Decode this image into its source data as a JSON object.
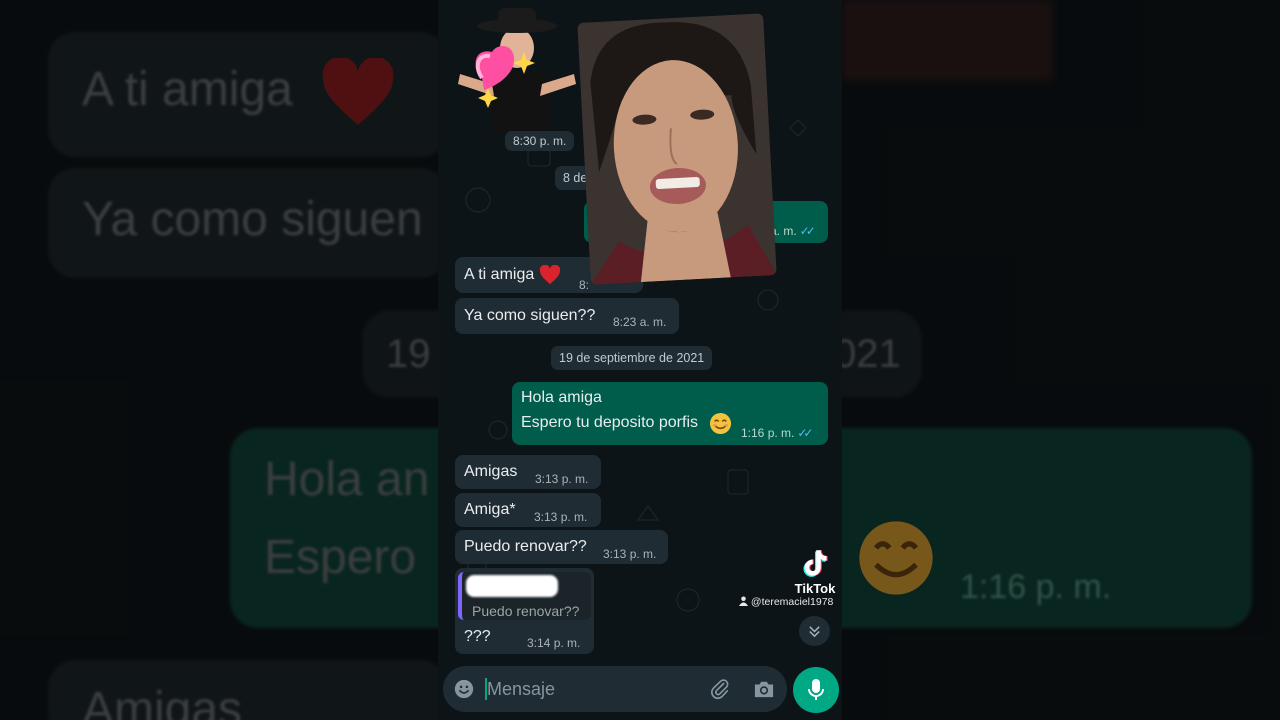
{
  "background_left": {
    "msg1": "A ti amiga",
    "msg2": "Ya como siguen",
    "date": "19",
    "msg3": "Hola an",
    "msg4": "Espero",
    "msg5": "Amigas"
  },
  "background_right": {
    "date": "021",
    "time": "1:16 p. m."
  },
  "chat": {
    "sticker_time": "8:30 p. m.",
    "date_chip_partial": "8 de s",
    "partial_out_time": "a. m.",
    "messages": [
      {
        "text": "A ti amiga",
        "time": "8:"
      },
      {
        "text": "Ya como siguen??",
        "time": "8:23 a. m."
      }
    ],
    "date_chip": "19 de septiembre de 2021",
    "out_message": {
      "line1": "Hola amiga",
      "line2": "Espero tu deposito porfis",
      "time": "1:16 p. m."
    },
    "later_messages": [
      {
        "text": "Amigas",
        "time": "3:13 p. m."
      },
      {
        "text": "Amiga*",
        "time": "3:13 p. m."
      },
      {
        "text": "Puedo renovar??",
        "time": "3:13 p. m."
      }
    ],
    "reply": {
      "quoted": "Puedo renovar??",
      "text": "???",
      "time": "3:14 p. m."
    }
  },
  "input": {
    "placeholder": "Mensaje"
  },
  "tiktok": {
    "logo_text": "TikTok",
    "username": "@teremaciel1978"
  },
  "colors": {
    "outgoing": "#005c4b",
    "incoming": "#202c33",
    "accent": "#00a884",
    "ticks": "#53bdeb"
  },
  "icons": [
    "emoji-icon",
    "attach-icon",
    "camera-icon",
    "mic-icon",
    "heart-icon",
    "smile-emoji-icon",
    "chevron-down-icon",
    "tiktok-logo-icon",
    "user-icon"
  ]
}
